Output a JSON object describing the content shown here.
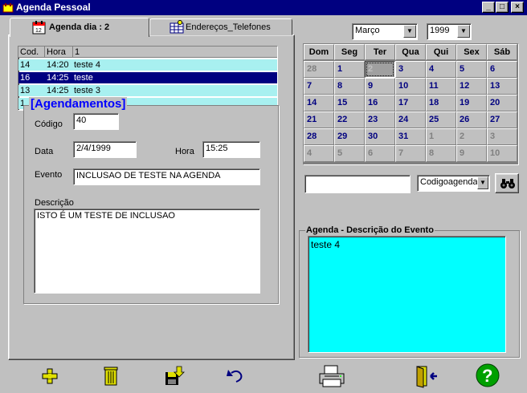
{
  "window": {
    "title": "Agenda Pessoal",
    "min": "_",
    "max": "□",
    "close": "×"
  },
  "tabs": [
    {
      "label": "Agenda dia : 2",
      "icon": "calendar-icon"
    },
    {
      "label": "Endereços_Telefones",
      "icon": "grid-icon"
    }
  ],
  "list": {
    "headers": [
      "Cod.",
      "Hora",
      "1"
    ],
    "rows": [
      {
        "cod": "14",
        "hora": "14:20",
        "text": "teste 4",
        "style": "cyan"
      },
      {
        "cod": "16",
        "hora": "14:25",
        "text": "teste",
        "style": "selected"
      },
      {
        "cod": "13",
        "hora": "14:25",
        "text": "teste 3",
        "style": "cyan"
      },
      {
        "cod": "1",
        "hora": "",
        "text": "",
        "style": "cyan"
      }
    ]
  },
  "form": {
    "group_title": "[Agendamentos]",
    "codigo_label": "Código",
    "codigo_value": "40",
    "data_label": "Data",
    "data_value": "2/4/1999",
    "hora_label": "Hora",
    "hora_value": "15:25",
    "evento_label": "Evento",
    "evento_value": "INCLUSAO DE TESTE NA AGENDA",
    "descricao_label": "Descrição",
    "descricao_value": "ISTO É UM TESTE DE INCLUSAO"
  },
  "calendar": {
    "month": "Março",
    "year": "1999",
    "weekdays": [
      "Dom",
      "Seg",
      "Ter",
      "Qua",
      "Qui",
      "Sex",
      "Sáb"
    ],
    "weeks": [
      [
        {
          "d": "28",
          "o": true
        },
        {
          "d": "1"
        },
        {
          "d": "2",
          "sel": true
        },
        {
          "d": "3"
        },
        {
          "d": "4"
        },
        {
          "d": "5"
        },
        {
          "d": "6"
        }
      ],
      [
        {
          "d": "7"
        },
        {
          "d": "8"
        },
        {
          "d": "9"
        },
        {
          "d": "10"
        },
        {
          "d": "11"
        },
        {
          "d": "12"
        },
        {
          "d": "13"
        }
      ],
      [
        {
          "d": "14"
        },
        {
          "d": "15"
        },
        {
          "d": "16"
        },
        {
          "d": "17"
        },
        {
          "d": "18"
        },
        {
          "d": "19"
        },
        {
          "d": "20"
        }
      ],
      [
        {
          "d": "21"
        },
        {
          "d": "22"
        },
        {
          "d": "23"
        },
        {
          "d": "24"
        },
        {
          "d": "25"
        },
        {
          "d": "26"
        },
        {
          "d": "27"
        }
      ],
      [
        {
          "d": "28"
        },
        {
          "d": "29"
        },
        {
          "d": "30"
        },
        {
          "d": "31"
        },
        {
          "d": "1",
          "o": true
        },
        {
          "d": "2",
          "o": true
        },
        {
          "d": "3",
          "o": true
        }
      ],
      [
        {
          "d": "4",
          "o": true
        },
        {
          "d": "5",
          "o": true
        },
        {
          "d": "6",
          "o": true
        },
        {
          "d": "7",
          "o": true
        },
        {
          "d": "8",
          "o": true
        },
        {
          "d": "9",
          "o": true
        },
        {
          "d": "10",
          "o": true
        }
      ]
    ]
  },
  "search": {
    "value": "",
    "field_select": "Codigoagenda"
  },
  "event_panel": {
    "title": "Agenda  -  Descrição do Evento",
    "text": "teste 4"
  },
  "toolbar": [
    "add-icon",
    "trash-icon",
    "save-icon",
    "undo-icon",
    "print-icon",
    "exit-icon",
    "help-icon"
  ],
  "colors": {
    "titlebar": "#000080",
    "selected_row": "#000080",
    "cyan": "#00ffff",
    "row_cyan": "#a8f0f0",
    "day_text": "#000080",
    "other_month": "#808080",
    "icon_yellow": "#e0e000",
    "help_green": "#00a000"
  }
}
